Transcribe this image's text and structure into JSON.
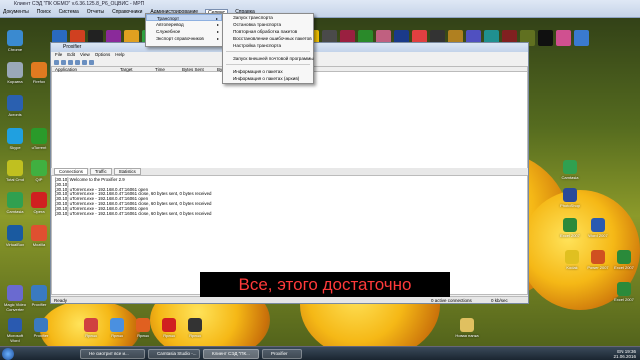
{
  "app": {
    "title": "Клиент СЭД \"ПК ОЕМО\" v.6.36.125.8_P6_OЦВИС - МРП",
    "menu": [
      "Документы",
      "Поиск",
      "Система",
      "Отчеты",
      "Справочники",
      "Администрирование",
      "Сервис",
      "Справка"
    ],
    "active_menu": "Сервис"
  },
  "menu_service": {
    "items": [
      {
        "label": "Транспорт",
        "submenu": true
      },
      {
        "label": "Автоперевод",
        "submenu": true
      },
      {
        "label": "Служебное",
        "submenu": true
      },
      {
        "label": "Экспорт справочников",
        "submenu": true
      }
    ]
  },
  "menu_transport": {
    "items": [
      "Запуск транспорта",
      "Остановка транспорта",
      "Повторная обработка пакетов",
      "Восстановление ошибочных пакетов",
      "Настройка транспорта",
      "Запуск внешней почтовой программы",
      "Информация о пакетах",
      "Информация о пакетах (архив)"
    ]
  },
  "proxifier": {
    "title": "Proxifier",
    "menu": [
      "File",
      "Edit",
      "View",
      "Options",
      "Help"
    ],
    "columns": [
      "Application",
      "Target",
      "Time",
      "Bytes Sent",
      "Bytes Received"
    ],
    "tabs": [
      "Connections",
      "Traffic",
      "Statistics"
    ],
    "log": [
      "[30.10] Welcome to the Proxifier 2.9",
      "[30.10]",
      "[30.10] uTorrent.exe - 192.168.0.47:16061 open",
      "[30.10] uTorrent.exe - 192.168.0.47:16061 close, 60 bytes sent, 0 bytes received",
      "[30.10] uTorrent.exe - 192.168.0.47:16061 open",
      "[30.10] uTorrent.exe - 192.168.0.47:16061 close, 60 bytes sent, 0 bytes received",
      "[30.10] uTorrent.exe - 192.168.0.47:16061 open",
      "[30.10] uTorrent.exe - 192.168.0.47:16061 close, 60 bytes sent, 0 bytes received"
    ],
    "status_left": "Ready",
    "status_mid": "0 active connections",
    "status_right": "0 kb/sec"
  },
  "caption": "Все, этого достаточно",
  "desktop_left": [
    "Chrome",
    "Firefox",
    "Корзина",
    "Acronis",
    "uTorrent",
    "Skype",
    "QIP",
    "Total Cmd",
    "Camtasia",
    "Opera",
    "VirtualBox",
    "Mozilla",
    "Magic Video Converter",
    "Proxifier"
  ],
  "desktop_bottom": [
    "Microsoft Word",
    "Proxifier",
    "Ярлык",
    "Ярлык",
    "Ярлык",
    "Ярлык",
    "Ярлык"
  ],
  "desktop_right": [
    "Camtasia",
    "PhotoShop",
    "Excel 2007",
    "Word 2007",
    "Power 2007",
    "Excel 2007",
    "Kodak",
    "Новая папка",
    "Excel 2007"
  ],
  "taskbar": {
    "items": [
      "Не смотрит все и...",
      "Camtasia Studio -...",
      "Клиент СЭД \"ПК...",
      "Proxifier"
    ],
    "lang": "EN",
    "time": "19:36",
    "date": "21.06.2016"
  }
}
